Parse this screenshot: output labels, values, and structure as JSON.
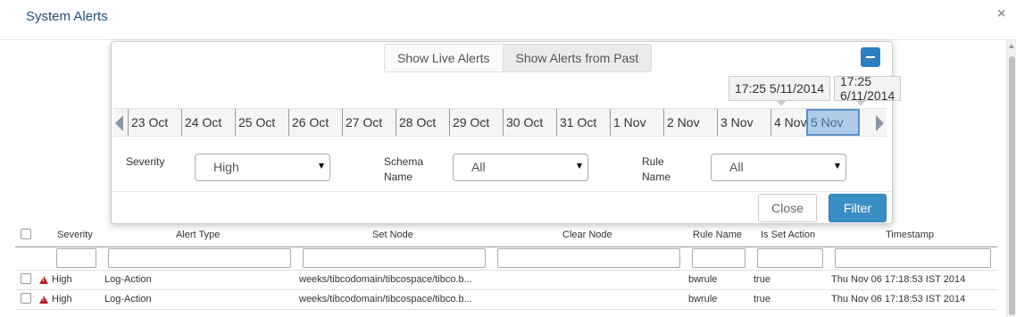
{
  "dialog": {
    "title": "System Alerts",
    "close_glyph": "×"
  },
  "panel": {
    "toggle": {
      "live_label": "Show Live Alerts",
      "past_label": "Show Alerts from Past",
      "active": "past"
    },
    "collapse_icon": "minus-icon",
    "range": {
      "start": "17:25 5/11/2014",
      "end": "17:25 6/11/2014"
    },
    "timeline": {
      "days": [
        "23 Oct",
        "24 Oct",
        "25 Oct",
        "26 Oct",
        "27 Oct",
        "28 Oct",
        "29 Oct",
        "30 Oct",
        "31 Oct",
        "1 Nov",
        "2 Nov",
        "3 Nov",
        "4 Nov",
        "5 Nov"
      ],
      "selected": "5 Nov"
    },
    "filters": {
      "severity": {
        "label": "Severity",
        "value": "High"
      },
      "schema": {
        "label_line1": "Schema",
        "label_line2": "Name",
        "value": "All"
      },
      "rule": {
        "label_line1": "Rule",
        "label_line2": "Name",
        "value": "All"
      }
    },
    "close_label": "Close",
    "filter_label": "Filter",
    "accent_color": "#3a8ec6"
  },
  "table": {
    "columns": {
      "severity": "Severity",
      "alert_type": "Alert Type",
      "set_node": "Set Node",
      "clear_node": "Clear Node",
      "rule_name": "Rule Name",
      "is_set_action": "Is Set Action",
      "timestamp": "Timestamp"
    },
    "rows": [
      {
        "severity": "High",
        "alert_type": "Log-Action",
        "set_node": "weeks/tibcodomain/tibcospace/tibco.b...",
        "clear_node": "",
        "rule_name": "bwrule",
        "is_set_action": "true",
        "timestamp": "Thu Nov 06 17:18:53 IST 2014"
      },
      {
        "severity": "High",
        "alert_type": "Log-Action",
        "set_node": "weeks/tibcodomain/tibcospace/tibco.b...",
        "clear_node": "",
        "rule_name": "bwrule",
        "is_set_action": "true",
        "timestamp": "Thu Nov 06 17:18:53 IST 2014"
      }
    ],
    "severity_icon": "warning-triangle-icon",
    "severity_color": "#b22222"
  }
}
